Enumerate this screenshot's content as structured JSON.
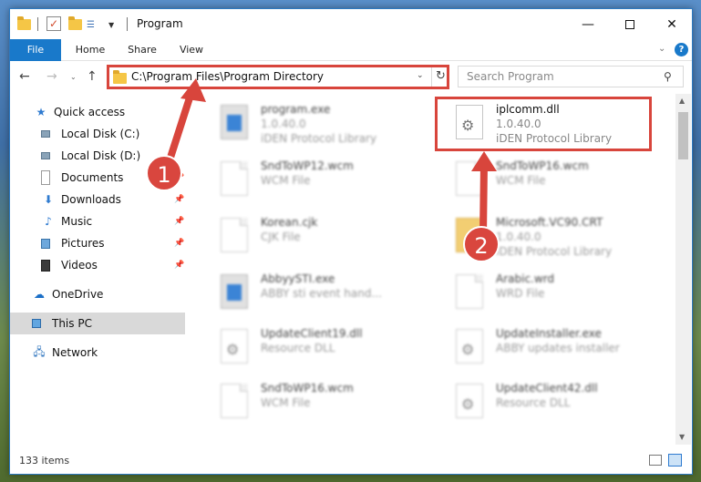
{
  "window": {
    "title": "Program",
    "buttons": {
      "minimize": "—",
      "maximize": "",
      "close": "✕"
    }
  },
  "ribbon": {
    "tabs": [
      "File",
      "Home",
      "Share",
      "View"
    ],
    "help": "?"
  },
  "navbar": {
    "back": "←",
    "forward": "→",
    "recent": "⌄",
    "up": "↑",
    "address": "C:\\Program Files\\Program Directory",
    "address_dropdown": "⌄",
    "refresh": "↻",
    "search_placeholder": "Search Program",
    "search_icon": "⚲"
  },
  "sidebar": {
    "items": [
      {
        "label": "Quick access",
        "icon": "star-icon"
      },
      {
        "label": "Local Disk (C:)",
        "icon": "drive-icon"
      },
      {
        "label": "Local Disk (D:)",
        "icon": "drive-icon"
      },
      {
        "label": "Documents",
        "icon": "documents-icon"
      },
      {
        "label": "Downloads",
        "icon": "download-icon"
      },
      {
        "label": "Music",
        "icon": "music-icon"
      },
      {
        "label": "Pictures",
        "icon": "pictures-icon"
      },
      {
        "label": "Videos",
        "icon": "videos-icon"
      },
      {
        "label": "OneDrive",
        "icon": "cloud-icon"
      },
      {
        "label": "This PC",
        "icon": "computer-icon"
      },
      {
        "label": "Network",
        "icon": "network-icon"
      }
    ],
    "selected": "This PC"
  },
  "files": [
    {
      "name": "program.exe",
      "line1": "1.0.40.0",
      "line2": "iDEN Protocol Library",
      "icon": "exe-icon"
    },
    {
      "name": "iplcomm.dll",
      "line1": "1.0.40.0",
      "line2": "iDEN Protocol Library",
      "icon": "dll-icon"
    },
    {
      "name": "SndToWP12.wcm",
      "line1": "WCM File",
      "line2": "",
      "icon": "file-icon"
    },
    {
      "name": "SndToWP16.wcm",
      "line1": "WCM File",
      "line2": "",
      "icon": "file-icon"
    },
    {
      "name": "Korean.cjk",
      "line1": "CJK File",
      "line2": "",
      "icon": "file-icon"
    },
    {
      "name": "Microsoft.VC90.CRT",
      "line1": "1.0.40.0",
      "line2": "iDEN Protocol Library",
      "icon": "folder-icon"
    },
    {
      "name": "AbbyySTI.exe",
      "line1": "ABBY sti event hand...",
      "line2": "",
      "icon": "exe-icon"
    },
    {
      "name": "Arabic.wrd",
      "line1": "WRD File",
      "line2": "",
      "icon": "file-icon"
    },
    {
      "name": "UpdateClient19.dll",
      "line1": "Resource DLL",
      "line2": "",
      "icon": "dll-icon"
    },
    {
      "name": "UpdateInstaller.exe",
      "line1": "ABBY updates installer",
      "line2": "",
      "icon": "dll-icon"
    },
    {
      "name": "SndToWP16.wcm",
      "line1": "WCM File",
      "line2": "",
      "icon": "file-icon"
    },
    {
      "name": "UpdateClient42.dll",
      "line1": "Resource DLL",
      "line2": "",
      "icon": "dll-icon"
    }
  ],
  "status": {
    "items": "133 items"
  },
  "callouts": {
    "marker1": "1",
    "marker2": "2"
  },
  "colors": {
    "accent": "#1979ca",
    "highlight": "#d8453c"
  }
}
